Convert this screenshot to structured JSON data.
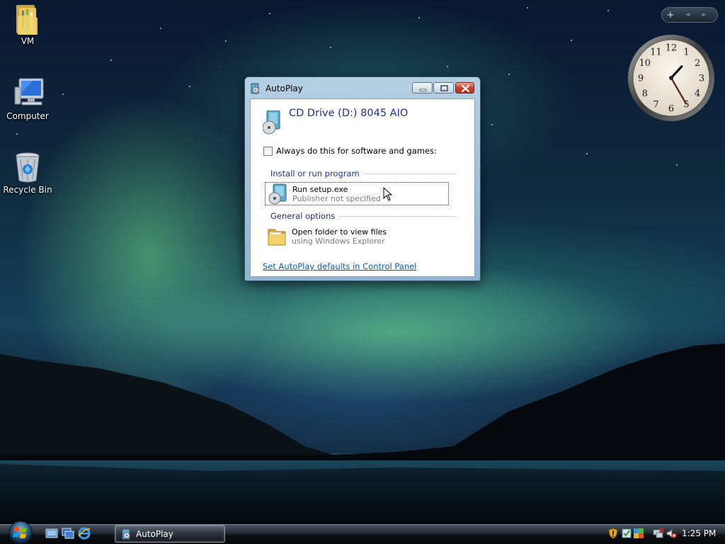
{
  "desktop": {
    "icons": [
      {
        "label": "VM",
        "icon": "folder-icon"
      },
      {
        "label": "Computer",
        "icon": "computer-icon"
      },
      {
        "label": "Recycle Bin",
        "icon": "recycle-bin-icon"
      }
    ]
  },
  "sidebar_gadgets": {
    "add_label": "+",
    "prev_label": "◄",
    "next_label": "►",
    "clock": {
      "hour": 1,
      "minute": 25,
      "second": 25
    }
  },
  "autoplay": {
    "title": "AutoPlay",
    "drive_label": "CD Drive (D:) 8045 AIO",
    "always_checkbox_label": "Always do this for software and games:",
    "always_checked": false,
    "sections": [
      {
        "heading": "Install or run program",
        "options": [
          {
            "main": "Run setup.exe",
            "sub": "Publisher not specified",
            "icon": "setup-disc-icon",
            "focused": true
          }
        ]
      },
      {
        "heading": "General options",
        "options": [
          {
            "main": "Open folder to view files",
            "sub": "using Windows Explorer",
            "icon": "folder-icon",
            "focused": false
          }
        ]
      }
    ],
    "defaults_link": "Set AutoPlay defaults in Control Panel"
  },
  "taskbar": {
    "task_label": "AutoPlay",
    "clock_time": "1:25 PM"
  },
  "colors": {
    "heading_blue": "#1e3287",
    "link_blue": "#0a5aa8",
    "close_red": "#c6442c"
  }
}
